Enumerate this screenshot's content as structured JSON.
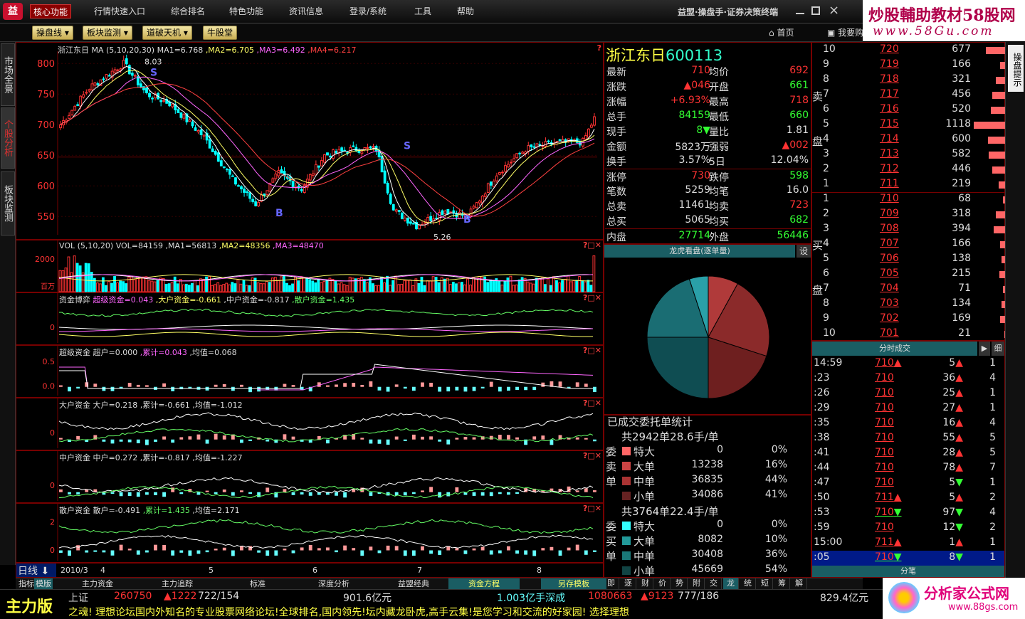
{
  "menu": [
    "核心功能",
    "行情快速入口",
    "综合排名",
    "特色功能",
    "资讯信息",
    "登录/系统",
    "工具",
    "帮助"
  ],
  "brand": "益盟·操盘手·证券决策终端",
  "watermark": {
    "line1": "炒股輔助教材58股网",
    "line2": "www.58Gu.com"
  },
  "toolbar": [
    "操盘线",
    "板块监测",
    "道破天机",
    "牛股堂"
  ],
  "toolbar_right": [
    "首页",
    "我要购"
  ],
  "side_tabs": [
    "市场全景",
    "个股分析",
    "板块监测"
  ],
  "side_right": "操盘提示",
  "main_chart": {
    "title": "浙江东日",
    "ma_prefix": "MA (5,10,20,30)",
    "ma1": "MA1=6.768",
    "ma2": ",MA2=6.705",
    "ma3": ",MA3=6.492",
    "ma4": ",MA4=6.217",
    "yticks": [
      "800",
      "750",
      "700",
      "650",
      "600",
      "550"
    ],
    "hi": "8.03",
    "lo": "5.26"
  },
  "vol_chart": {
    "title": "VOL (5,10,20)",
    "vol": "VOL=84159",
    "ma1": ",MA1=56813",
    "ma2": ",MA2=48356",
    "ma3": ",MA3=48470",
    "yticks": [
      "2000",
      "百万"
    ]
  },
  "ind1": {
    "title": "资金博弈",
    "a": "超级资金=0.043",
    "b": ",大户资金=-0.661",
    "c": ",中户资金=-0.817",
    "d": ",散户资金=1.435",
    "yticks": [
      "0"
    ]
  },
  "ind2": {
    "title": "超级资金",
    "a": "超户=0.000",
    "b": ",累计=0.043",
    "c": ",均值=0.068",
    "yticks": [
      "0.5",
      "0.0"
    ]
  },
  "ind3": {
    "title": "大户资金",
    "a": "大户=0.218",
    "b": ",累计=-0.661",
    "c": ",均值=-1.012",
    "yticks": [
      "0"
    ]
  },
  "ind4": {
    "title": "中户资金",
    "a": "中户=0.272",
    "b": ",累计=-0.817",
    "c": ",均值=-1.227",
    "yticks": [
      "0"
    ]
  },
  "ind5": {
    "title": "散户资金",
    "a": "散户=-0.491",
    "b": ",累计=1.435",
    "c": ",均值=2.171",
    "yticks": [
      "2",
      "0"
    ]
  },
  "period": "日线",
  "xaxis": [
    "2010/3",
    "4",
    "5",
    "6",
    "7",
    "8"
  ],
  "stock": {
    "name": "浙江东日",
    "code": "600113"
  },
  "quote": [
    [
      "最新",
      "710",
      "均价",
      "692"
    ],
    [
      "涨跌",
      "▲046",
      "开盘",
      "661"
    ],
    [
      "涨幅",
      "+6.93%",
      "最高",
      "718"
    ],
    [
      "总手",
      "84159",
      "最低",
      "660"
    ],
    [
      "现手",
      "8▼",
      "量比",
      "1.81"
    ],
    [
      "金额",
      "5823万",
      "强弱",
      "▲002"
    ],
    [
      "换手",
      "3.57%",
      "5日",
      "12.04%"
    ],
    [
      "涨停",
      "730",
      "跌停",
      "598"
    ],
    [
      "笔数",
      "5259",
      "均笔",
      "16.0"
    ],
    [
      "总卖",
      "11461",
      "均卖",
      "723"
    ],
    [
      "总买",
      "5065",
      "均买",
      "682"
    ],
    [
      "内盘",
      "27714",
      "外盘",
      "56446"
    ]
  ],
  "pie_title": "龙虎看盘(逐单量)",
  "pie_btn": "设",
  "pie": [
    0.08,
    0.22,
    0.2,
    0.25,
    0.2,
    0.05
  ],
  "orders_title": "已成交委托单统计",
  "sell": {
    "summary": "共2942单28.6手/单",
    "side": [
      "委",
      "卖",
      "单"
    ],
    "rows": [
      [
        "特大",
        "0",
        "0%"
      ],
      [
        "大单",
        "13238",
        "16%"
      ],
      [
        "中单",
        "36835",
        "44%"
      ],
      [
        "小单",
        "34086",
        "41%"
      ]
    ]
  },
  "buy": {
    "summary": "共3764单22.4手/单",
    "side": [
      "委",
      "买",
      "单"
    ],
    "rows": [
      [
        "特大",
        "0",
        "0%"
      ],
      [
        "大单",
        "8082",
        "10%"
      ],
      [
        "中单",
        "30408",
        "36%"
      ],
      [
        "小单",
        "45669",
        "54%"
      ]
    ]
  },
  "side_labels": {
    "sell": [
      "卖",
      "盘"
    ],
    "buy": [
      "买",
      "盘"
    ]
  },
  "asks": [
    [
      "10",
      "720",
      "677"
    ],
    [
      "9",
      "719",
      "166"
    ],
    [
      "8",
      "718",
      "321"
    ],
    [
      "7",
      "717",
      "456"
    ],
    [
      "6",
      "716",
      "520"
    ],
    [
      "5",
      "715",
      "1118"
    ],
    [
      "4",
      "714",
      "600"
    ],
    [
      "3",
      "713",
      "582"
    ],
    [
      "2",
      "712",
      "446"
    ],
    [
      "1",
      "711",
      "219"
    ]
  ],
  "bids": [
    [
      "1",
      "710",
      "68"
    ],
    [
      "2",
      "709",
      "318"
    ],
    [
      "3",
      "708",
      "394"
    ],
    [
      "4",
      "707",
      "166"
    ],
    [
      "5",
      "706",
      "138"
    ],
    [
      "6",
      "705",
      "215"
    ],
    [
      "7",
      "704",
      "71"
    ],
    [
      "8",
      "703",
      "134"
    ],
    [
      "9",
      "702",
      "169"
    ],
    [
      "10",
      "701",
      "21"
    ]
  ],
  "ticks_title": "分时成交",
  "ticks_btn": "细",
  "ticks": [
    [
      "14:59",
      "710▲",
      "5▲",
      "1"
    ],
    [
      ":23",
      "710",
      "36▲",
      "4"
    ],
    [
      ":26",
      "710",
      "25▲",
      "1"
    ],
    [
      ":29",
      "710",
      "27▲",
      "1"
    ],
    [
      ":35",
      "710",
      "16▲",
      "4"
    ],
    [
      ":38",
      "710",
      "55▲",
      "5"
    ],
    [
      ":41",
      "710",
      "28▲",
      "5"
    ],
    [
      ":44",
      "710",
      "78▲",
      "7"
    ],
    [
      ":47",
      "710",
      "5▼",
      "1"
    ],
    [
      ":50",
      "711▲",
      "5▲",
      "2"
    ],
    [
      ":53",
      "710▼",
      "97▼",
      "4"
    ],
    [
      ":59",
      "710",
      "12▼",
      "2"
    ],
    [
      "15:00",
      "711▲",
      "1▲",
      "1"
    ],
    [
      ":05",
      "710▼",
      "8▼",
      "1"
    ]
  ],
  "ticks_bottom": "分笔",
  "bottom_tabs": [
    "指标",
    "模版",
    "主力资金",
    "主力追踪",
    "标准",
    "深度分析",
    "益盟经典",
    "资金方程",
    "另存模板"
  ],
  "right_tabs": [
    "即",
    "逐",
    "财",
    "价",
    "势",
    "附",
    "交",
    "龙",
    "统",
    "短",
    "筹",
    "解"
  ],
  "status": {
    "label": "主力版",
    "sh": "上证",
    "sh_val": "260750",
    "sh_chg": "▲1222",
    "sh_ratio": "722/154",
    "sh_amt": "901.6亿元",
    "sz_amt": "1.003亿手深成",
    "sz_val": "1080663",
    "sz_chg": "▲9123",
    "sz_ratio": "777/186",
    "sz_amt2": "829.4亿元",
    "scroll": "之魂!  理想论坛国内外知名的专业股票网络论坛!全球排名,国内领先!坛内藏龙卧虎,高手云集!是您学习和交流的好家园!  选择理想"
  },
  "watermark2": {
    "a": "分析家公式网",
    "b": "www.88gs.com"
  }
}
